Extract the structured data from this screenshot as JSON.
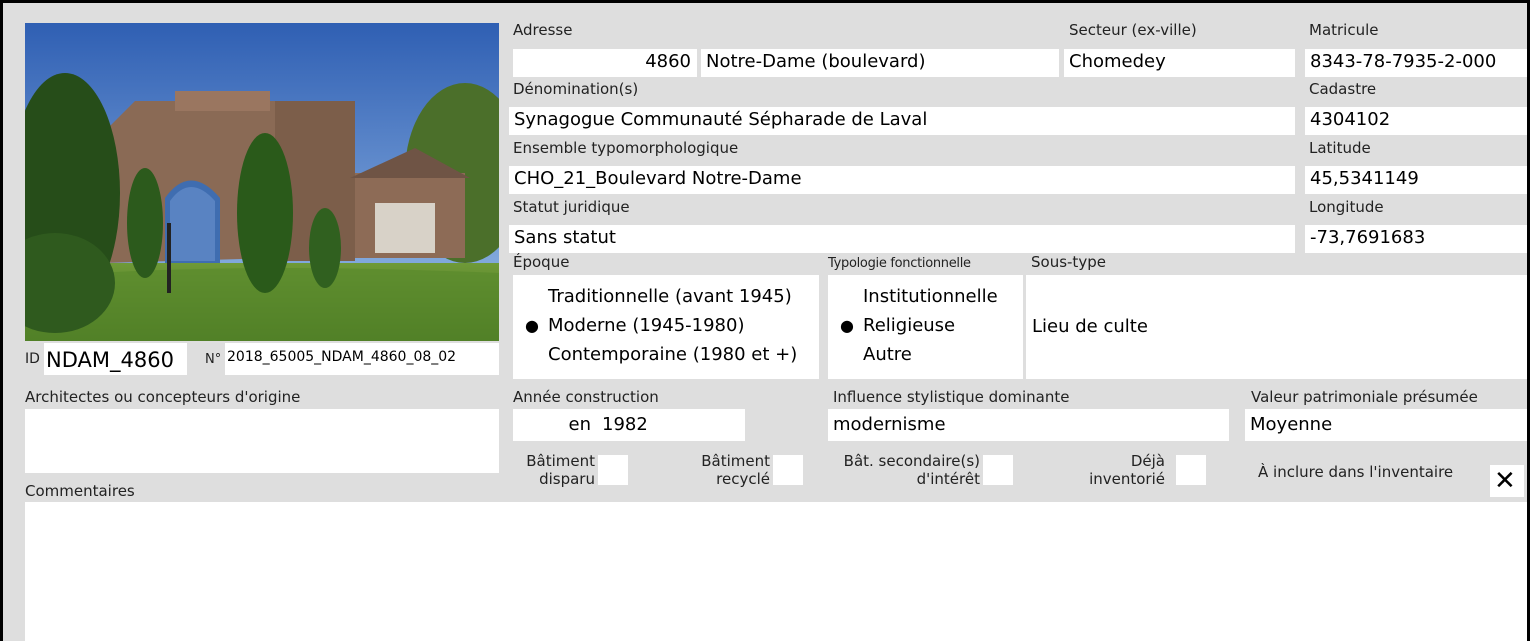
{
  "photo": {
    "description_icon": "building-photo"
  },
  "id": {
    "label": "ID",
    "value": "NDAM_4860"
  },
  "numero": {
    "label": "N°",
    "value": "2018_65005_NDAM_4860_08_02"
  },
  "adresse": {
    "label": "Adresse",
    "number": "4860",
    "street": "Notre-Dame (boulevard)"
  },
  "secteur": {
    "label": "Secteur (ex-ville)",
    "value": "Chomedey"
  },
  "matricule": {
    "label": "Matricule",
    "value": "8343-78-7935-2-000"
  },
  "denomination": {
    "label": "Dénomination(s)",
    "value": "Synagogue Communauté Sépharade de Laval"
  },
  "cadastre": {
    "label": "Cadastre",
    "value": "4304102"
  },
  "ensemble": {
    "label": "Ensemble typomorphologique",
    "value": "CHO_21_Boulevard Notre-Dame"
  },
  "latitude": {
    "label": "Latitude",
    "value": "45,5341149"
  },
  "statut": {
    "label": "Statut juridique",
    "value": "Sans statut"
  },
  "longitude": {
    "label": "Longitude",
    "value": "-73,7691683"
  },
  "epoque": {
    "label": "Époque",
    "options": [
      "Traditionnelle (avant 1945)",
      "Moderne (1945-1980)",
      "Contemporaine (1980 et +)"
    ],
    "selected_index": 1
  },
  "typologie": {
    "label": "Typologie fonctionnelle",
    "options": [
      "Institutionnelle",
      "Religieuse",
      "Autre"
    ],
    "selected_index": 1
  },
  "sous_type": {
    "label": "Sous-type",
    "value": "Lieu de culte"
  },
  "architectes": {
    "label": "Architectes ou concepteurs d'origine",
    "value": ""
  },
  "annee": {
    "label": "Année construction",
    "prefix": "en",
    "value": "1982"
  },
  "influence": {
    "label": "Influence stylistique dominante",
    "value": "modernisme"
  },
  "valeur": {
    "label": "Valeur patrimoniale présumée",
    "value": "Moyenne"
  },
  "checkboxes": {
    "disparu": {
      "line1": "Bâtiment",
      "line2": "disparu",
      "checked": false
    },
    "recycle": {
      "line1": "Bâtiment",
      "line2": "recyclé",
      "checked": false
    },
    "secondaire": {
      "line1": "Bât. secondaire(s)",
      "line2": "d'intérêt",
      "checked": false
    },
    "inventorie": {
      "line1": "Déjà",
      "line2": "inventorié",
      "checked": false
    },
    "inclure": {
      "label": "À inclure dans l'inventaire",
      "checked": true,
      "mark": "✕"
    }
  },
  "commentaires": {
    "label": "Commentaires",
    "value": ""
  },
  "selected_marker": "●"
}
